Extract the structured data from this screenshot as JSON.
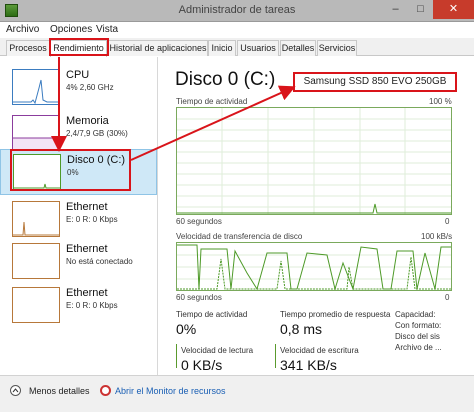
{
  "window": {
    "title": "Administrador de tareas",
    "controls": {
      "minimize": "–",
      "maximize": "□",
      "close": "✕"
    }
  },
  "menu": [
    "Archivo",
    "Opciones",
    "Vista"
  ],
  "tabs": [
    "Procesos",
    "Rendimiento",
    "Historial de aplicaciones",
    "Inicio",
    "Usuarios",
    "Detalles",
    "Servicios"
  ],
  "sidebar": [
    {
      "title": "CPU",
      "line1": "4% 2,60 GHz",
      "line2": ""
    },
    {
      "title": "Memoria",
      "line1": "2,4/7,9 GB (30%)",
      "line2": ""
    },
    {
      "title": "Disco 0 (C:)",
      "line1": "0%",
      "line2": ""
    },
    {
      "title": "Ethernet",
      "line1": "E: 0 R: 0 Kbps",
      "line2": ""
    },
    {
      "title": "Ethernet",
      "line1": "No está conectado",
      "line2": ""
    },
    {
      "title": "Ethernet",
      "line1": "E: 0 R: 0 Kbps",
      "line2": ""
    }
  ],
  "main": {
    "title": "Disco 0 (C:)",
    "model": "Samsung SSD 850 EVO 250GB",
    "graph1": {
      "label": "Tiempo de actividad",
      "max": "100 %",
      "xlabel": "60 segundos",
      "min": "0"
    },
    "graph2": {
      "label": "Velocidad de transferencia de disco",
      "max": "100 kB/s",
      "xlabel": "60 segundos",
      "min": "0"
    },
    "stats": {
      "activity_label": "Tiempo de actividad",
      "activity_value": "0%",
      "response_label": "Tiempo promedio de respuesta",
      "response_value": "0,8 ms",
      "read_label": "Velocidad de lectura",
      "read_value": "0 KB/s",
      "write_label": "Velocidad de escritura",
      "write_value": "341 KB/s"
    },
    "right_labels": [
      "Capacidad:",
      "Con formato:",
      "Disco del sis",
      "Archivo de ..."
    ]
  },
  "footer": {
    "less_details": "Menos detalles",
    "open_monitor": "Abrir el Monitor de recursos"
  }
}
